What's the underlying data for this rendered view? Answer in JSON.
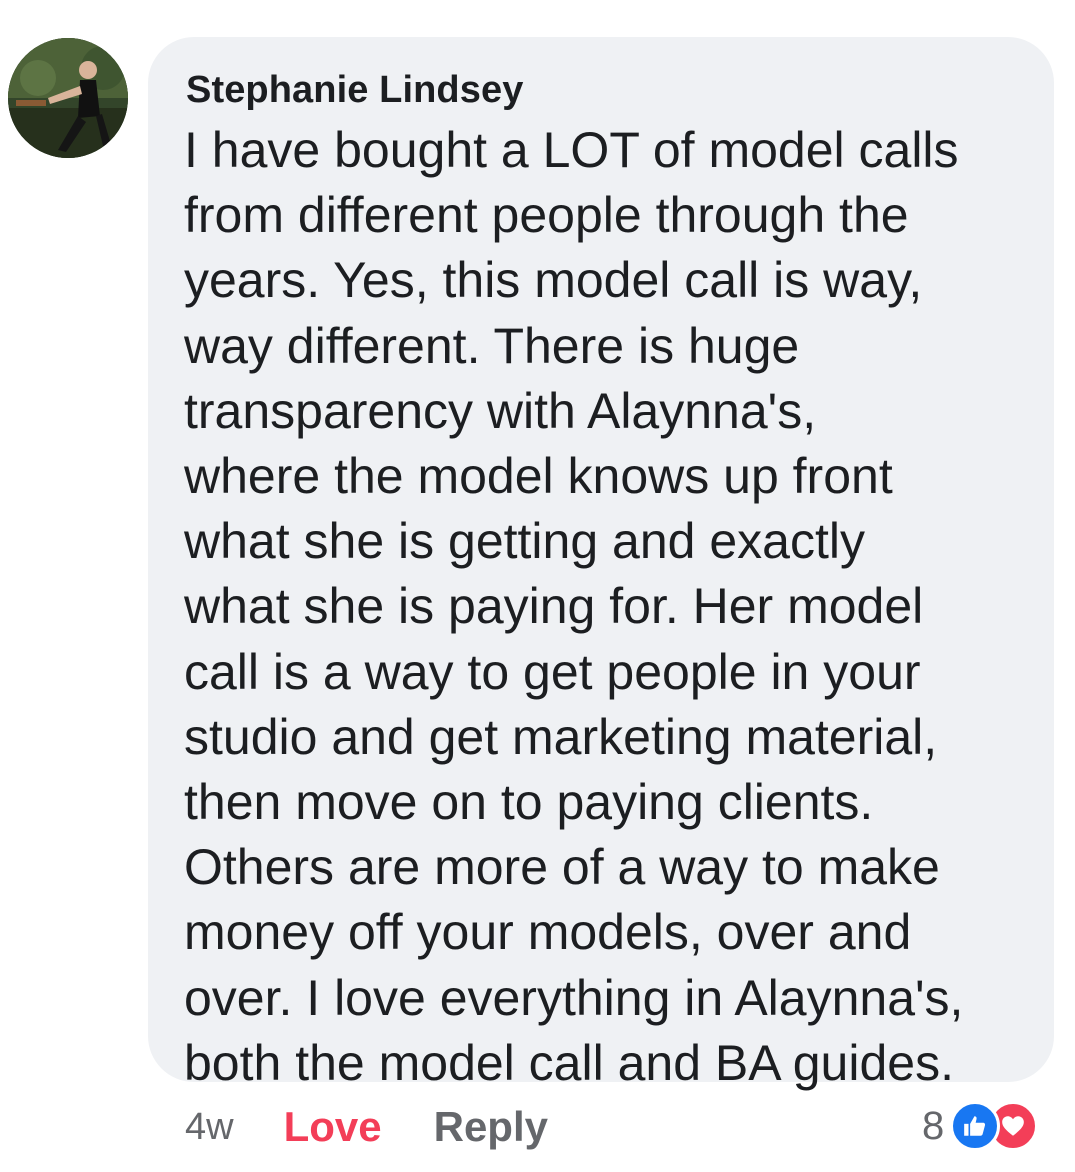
{
  "comment": {
    "author": "Stephanie Lindsey",
    "avatar_icon": "profile-photo",
    "lines": [
      "I have bought a LOT of model calls",
      "from different people through the",
      "years. Yes, this model call is way,",
      "way different. There is huge",
      "transparency with Alaynna's,",
      "where the model knows up front",
      "what she is getting and exactly",
      "what she is paying for. Her model",
      "call is a way to get people in your",
      "studio and get marketing material,",
      "then move on to paying clients.",
      "Others are more of a way to make",
      "money off your models, over and",
      "over. I love everything in Alaynna's,",
      "both the model call and BA guides."
    ]
  },
  "actions": {
    "timestamp": "4w",
    "love_label": "Love",
    "reply_label": "Reply"
  },
  "reactions": {
    "count": "8",
    "icons": [
      "like-icon",
      "heart-icon"
    ],
    "like_color": "#1877f2",
    "love_color": "#f33e58"
  },
  "colors": {
    "bubble": "#eff1f4",
    "text": "#1c1e21",
    "muted": "#65676b",
    "love_text": "#f33e58"
  }
}
